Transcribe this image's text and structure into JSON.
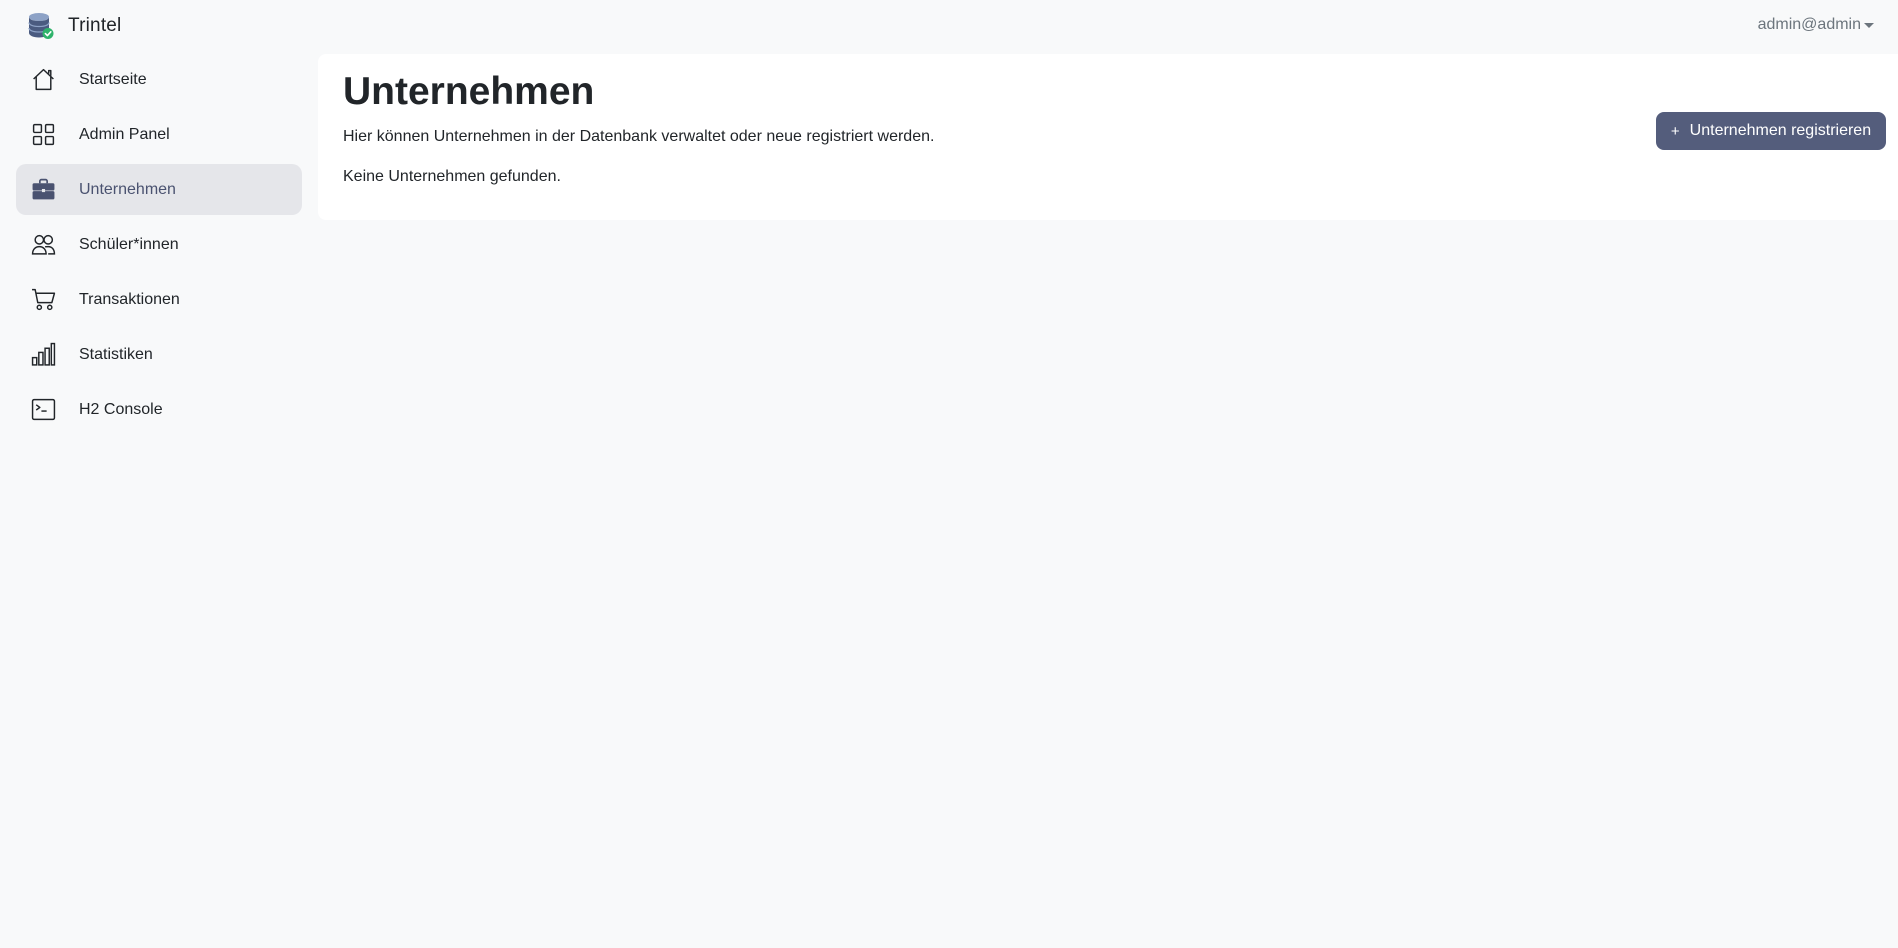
{
  "app": {
    "name": "Trintel",
    "logo_icon": "database-check-icon"
  },
  "user_menu": {
    "label": "admin@admin"
  },
  "sidebar": {
    "items": [
      {
        "label": "Startseite",
        "icon": "house-icon",
        "active": false
      },
      {
        "label": "Admin Panel",
        "icon": "grid-icon",
        "active": false
      },
      {
        "label": "Unternehmen",
        "icon": "briefcase-icon",
        "active": true
      },
      {
        "label": "Schüler*innen",
        "icon": "people-icon",
        "active": false
      },
      {
        "label": "Transaktionen",
        "icon": "cart-icon",
        "active": false
      },
      {
        "label": "Statistiken",
        "icon": "bar-chart-icon",
        "active": false
      },
      {
        "label": "H2 Console",
        "icon": "terminal-icon",
        "active": false
      }
    ]
  },
  "main": {
    "title": "Unternehmen",
    "description": "Hier können Unternehmen in der Datenbank verwaltet oder neue registriert werden.",
    "empty_message": "Keine Unternehmen gefunden.",
    "register_button": {
      "icon": "plus-icon",
      "label": "Unternehmen registrieren"
    }
  },
  "colors": {
    "page_background": "#f8f9fa",
    "card_background": "#ffffff",
    "active_nav_background": "#e5e6ea",
    "primary_button": "#545d7c",
    "text": "#212529",
    "muted_text": "#6c757d"
  }
}
